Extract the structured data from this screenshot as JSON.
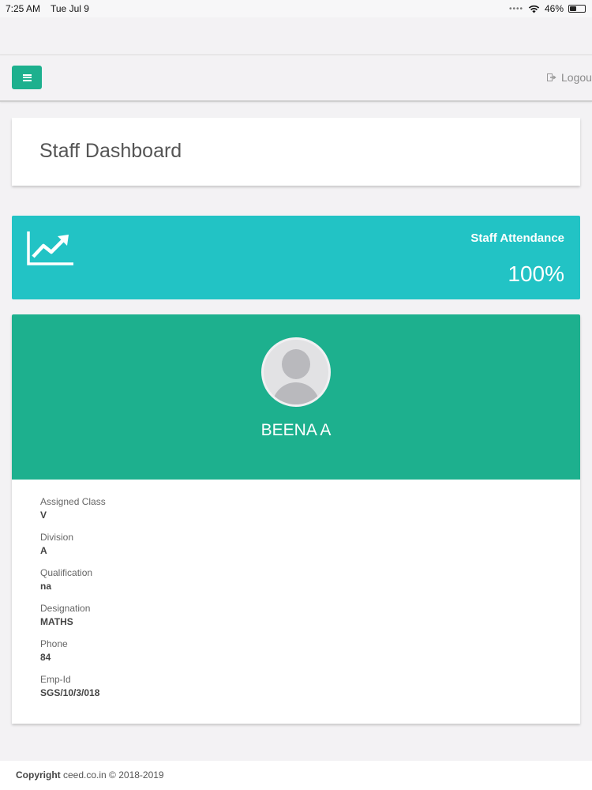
{
  "status_bar": {
    "time": "7:25 AM",
    "date": "Tue Jul 9",
    "battery": "46%",
    "battery_level": 0.46,
    "wifi_icon": "wifi-icon",
    "signal_icon": "signal-dots-icon"
  },
  "navbar": {
    "menu_icon": "hamburger-menu-icon",
    "logout_label": "Logou",
    "logout_icon": "logout-icon"
  },
  "page": {
    "title": "Staff Dashboard"
  },
  "attendance": {
    "label": "Staff Attendance",
    "value": "100%",
    "icon": "trending-up-chart-icon"
  },
  "profile": {
    "name": "BEENA A",
    "avatar_icon": "default-user-avatar",
    "details": [
      {
        "label": "Assigned Class",
        "value": "V"
      },
      {
        "label": "Division",
        "value": "A"
      },
      {
        "label": "Qualification",
        "value": "na"
      },
      {
        "label": "Designation",
        "value": "MATHS"
      },
      {
        "label": "Phone",
        "value": "84"
      },
      {
        "label": "Emp-Id",
        "value": "SGS/10/3/018"
      }
    ]
  },
  "footer": {
    "copyright_label": "Copyright",
    "copyright_text": " ceed.co.in © 2018-2019"
  },
  "colors": {
    "primary_green": "#1db08e",
    "attendance_teal": "#22c3c5",
    "background": "#f3f2f4"
  }
}
